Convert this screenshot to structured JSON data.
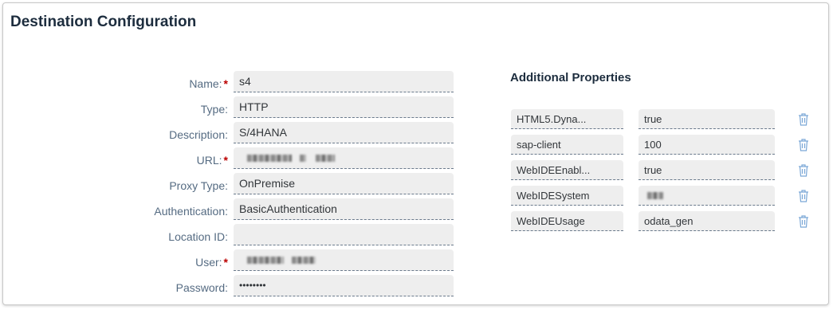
{
  "page": {
    "title": "Destination Configuration"
  },
  "form": {
    "fields": [
      {
        "label": "Name:",
        "value": "s4",
        "required": true
      },
      {
        "label": "Type:",
        "value": "HTTP",
        "required": false
      },
      {
        "label": "Description:",
        "value": "S/4HANA",
        "required": false
      },
      {
        "label": "URL:",
        "value": "",
        "required": true,
        "redacted": true
      },
      {
        "label": "Proxy Type:",
        "value": "OnPremise",
        "required": false
      },
      {
        "label": "Authentication:",
        "value": "BasicAuthentication",
        "required": false
      },
      {
        "label": "Location ID:",
        "value": "",
        "required": false
      },
      {
        "label": "User:",
        "value": "",
        "required": true,
        "redacted": true
      },
      {
        "label": "Password:",
        "value": "••••••••",
        "required": false
      }
    ],
    "required_marker": "*"
  },
  "additional_properties": {
    "title": "Additional Properties",
    "items": [
      {
        "key": "HTML5.Dyna...",
        "value": "true"
      },
      {
        "key": "sap-client",
        "value": "100"
      },
      {
        "key": "WebIDEEnabl...",
        "value": "true"
      },
      {
        "key": "WebIDESystem",
        "value": "",
        "redacted": true
      },
      {
        "key": "WebIDEUsage",
        "value": "odata_gen"
      }
    ],
    "delete_icon": "trash-icon"
  },
  "colors": {
    "accent": "#0a6ed1",
    "required": "#bb0000",
    "label": "#556b82",
    "field_bg": "#eeeeee"
  }
}
